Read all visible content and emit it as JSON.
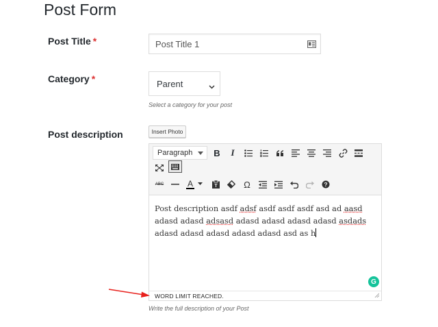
{
  "page": {
    "title": "Post Form"
  },
  "post_title": {
    "label": "Post Title",
    "required_mark": "*",
    "value": "Post Title 1",
    "icon": "card-icon"
  },
  "category": {
    "label": "Category",
    "required_mark": "*",
    "selected": "Parent",
    "help": "Select a category for your post"
  },
  "description": {
    "label": "Post description",
    "insert_photo_label": "Insert Photo",
    "toolbar": {
      "format_select": "Paragraph",
      "row1": [
        "bold-icon",
        "italic-icon",
        "bullet-list-icon",
        "numbered-list-icon",
        "blockquote-icon",
        "align-left-icon",
        "align-center-icon",
        "align-right-icon",
        "link-icon",
        "read-more-icon",
        "fullscreen-icon",
        "toolbar-toggle-icon"
      ],
      "row2": [
        "strikethrough-icon",
        "horizontal-line-icon",
        "text-color-icon",
        "paste-text-icon",
        "clear-formatting-icon",
        "special-character-icon",
        "outdent-icon",
        "indent-icon",
        "undo-icon",
        "redo-icon",
        "help-icon"
      ],
      "bold_glyph": "B",
      "italic_glyph": "I",
      "omega_glyph": "Ω",
      "color_glyph": "A",
      "strike_glyph": "ABC"
    },
    "content": {
      "p1": "Post description asdf ",
      "w1": "adsf",
      "p2": " asdf asdf asdf asd ad ",
      "w2": "aasd",
      "p3": " adasd adasd ",
      "w3": "adsasd",
      "p4": " adasd adasd adasd adasd ",
      "w4": "asdads",
      "p5": " adasd adasd adasd adasd adasd asd as h"
    },
    "grammarly_glyph": "G",
    "status": "WORD LIMIT REACHED.",
    "help": "Write the full description of your Post"
  },
  "colors": {
    "required": "#dc3232",
    "arrow": "#e8201c",
    "grammarly": "#15c39a"
  }
}
